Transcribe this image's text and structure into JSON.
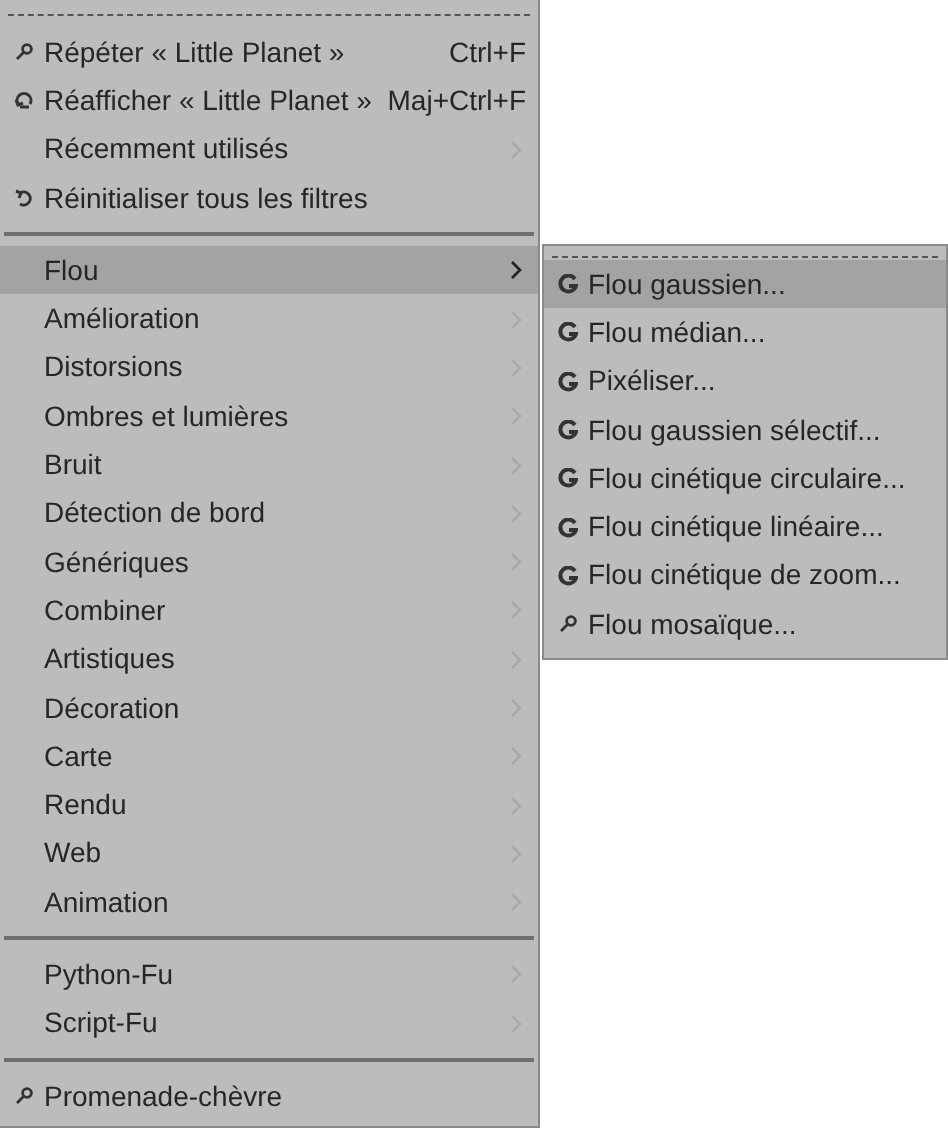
{
  "main_menu": {
    "sections": [
      {
        "items": [
          {
            "kind": "plugin",
            "label": "Répéter « Little Planet »",
            "shortcut": "Ctrl+F",
            "has_submenu": false,
            "selected": false
          },
          {
            "kind": "reshow",
            "label": "Réafficher « Little Planet »",
            "shortcut": "Maj+Ctrl+F",
            "has_submenu": false,
            "selected": false
          },
          {
            "kind": "plain",
            "label": "Récemment utilisés",
            "has_submenu": true,
            "selected": false
          },
          {
            "kind": "reset",
            "label": "Réinitialiser tous les filtres",
            "has_submenu": false,
            "selected": false
          }
        ]
      },
      {
        "items": [
          {
            "kind": "plain",
            "label": "Flou",
            "has_submenu": true,
            "selected": true
          },
          {
            "kind": "plain",
            "label": "Amélioration",
            "has_submenu": true,
            "selected": false
          },
          {
            "kind": "plain",
            "label": "Distorsions",
            "has_submenu": true,
            "selected": false
          },
          {
            "kind": "plain",
            "label": "Ombres et lumières",
            "has_submenu": true,
            "selected": false
          },
          {
            "kind": "plain",
            "label": "Bruit",
            "has_submenu": true,
            "selected": false
          },
          {
            "kind": "plain",
            "label": "Détection de bord",
            "has_submenu": true,
            "selected": false
          },
          {
            "kind": "plain",
            "label": "Génériques",
            "has_submenu": true,
            "selected": false
          },
          {
            "kind": "plain",
            "label": "Combiner",
            "has_submenu": true,
            "selected": false
          },
          {
            "kind": "plain",
            "label": "Artistiques",
            "has_submenu": true,
            "selected": false
          },
          {
            "kind": "plain",
            "label": "Décoration",
            "has_submenu": true,
            "selected": false
          },
          {
            "kind": "plain",
            "label": "Carte",
            "has_submenu": true,
            "selected": false
          },
          {
            "kind": "plain",
            "label": "Rendu",
            "has_submenu": true,
            "selected": false
          },
          {
            "kind": "plain",
            "label": "Web",
            "has_submenu": true,
            "selected": false
          },
          {
            "kind": "plain",
            "label": "Animation",
            "has_submenu": true,
            "selected": false
          }
        ]
      },
      {
        "items": [
          {
            "kind": "plain",
            "label": "Python-Fu",
            "has_submenu": true,
            "selected": false
          },
          {
            "kind": "plain",
            "label": "Script-Fu",
            "has_submenu": true,
            "selected": false
          }
        ]
      },
      {
        "items": [
          {
            "kind": "plugin",
            "label": "Promenade-chèvre",
            "has_submenu": false,
            "selected": false
          }
        ]
      }
    ]
  },
  "submenu": {
    "items": [
      {
        "kind": "gegl",
        "label": "Flou gaussien...",
        "selected": true
      },
      {
        "kind": "gegl",
        "label": "Flou médian...",
        "selected": false
      },
      {
        "kind": "gegl",
        "label": "Pixéliser...",
        "selected": false
      },
      {
        "kind": "gegl",
        "label": "Flou gaussien sélectif...",
        "selected": false
      },
      {
        "kind": "gegl",
        "label": "Flou cinétique circulaire...",
        "selected": false
      },
      {
        "kind": "gegl",
        "label": "Flou cinétique linéaire...",
        "selected": false
      },
      {
        "kind": "gegl",
        "label": "Flou cinétique de zoom...",
        "selected": false
      },
      {
        "kind": "plugin",
        "label": "Flou mosaïque...",
        "selected": false
      }
    ]
  }
}
